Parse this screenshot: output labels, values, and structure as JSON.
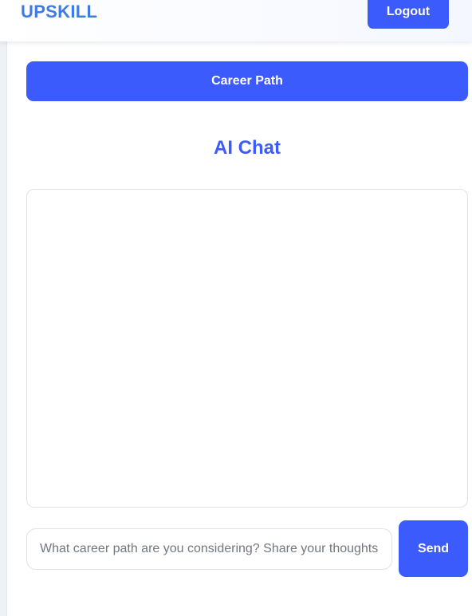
{
  "header": {
    "brand": "UPSKILL",
    "logout_label": "Logout"
  },
  "main": {
    "career_path_label": "Career Path",
    "chat_title": "AI Chat",
    "chat_messages": [],
    "input": {
      "value": "",
      "placeholder": "What career path are you considering? Share your thoughts"
    },
    "send_label": "Send"
  },
  "colors": {
    "accent": "#3b5bfd",
    "brand": "#3d7be8",
    "border": "#dfe2e8"
  }
}
